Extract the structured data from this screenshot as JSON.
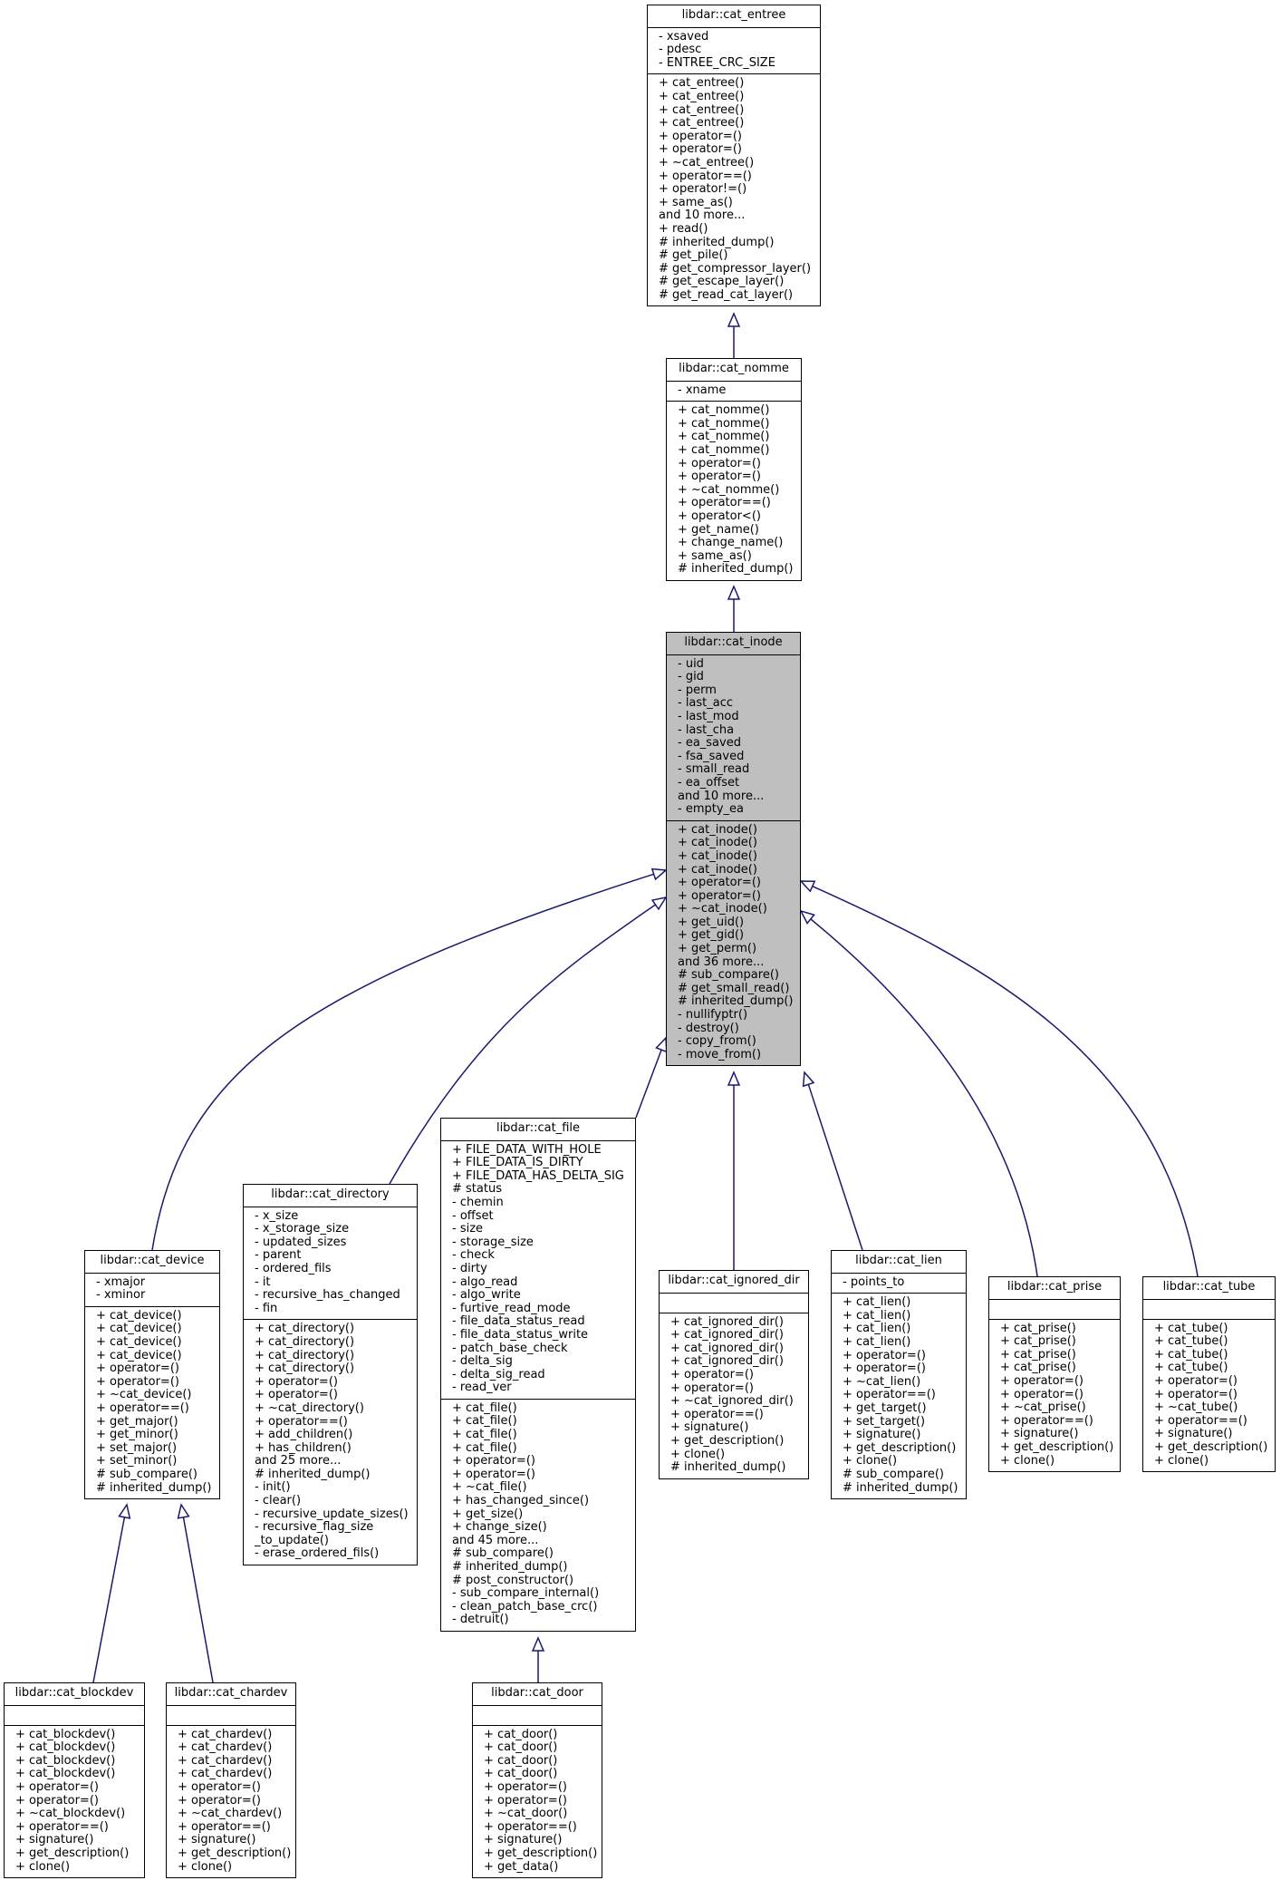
{
  "diagram": {
    "type": "uml-class-inheritance",
    "focus_class": "cat_inode",
    "edge_color": "#191970",
    "focus_fill": "#bfbfbf",
    "classes": [
      {
        "id": "cat_entree",
        "title": "libdar::cat_entree",
        "attributes": [
          "- xsaved",
          "- pdesc",
          "- ENTREE_CRC_SIZE"
        ],
        "methods": [
          "+ cat_entree()",
          "+ cat_entree()",
          "+ cat_entree()",
          "+ cat_entree()",
          "+ operator=()",
          "+ operator=()",
          "+ ~cat_entree()",
          "+ operator==()",
          "+ operator!=()",
          "+ same_as()",
          "and 10 more...",
          "+ read()",
          "# inherited_dump()",
          "# get_pile()",
          "# get_compressor_layer()",
          "# get_escape_layer()",
          "# get_read_cat_layer()"
        ]
      },
      {
        "id": "cat_nomme",
        "title": "libdar::cat_nomme",
        "attributes": [
          "- xname"
        ],
        "methods": [
          "+ cat_nomme()",
          "+ cat_nomme()",
          "+ cat_nomme()",
          "+ cat_nomme()",
          "+ operator=()",
          "+ operator=()",
          "+ ~cat_nomme()",
          "+ operator==()",
          "+ operator<()",
          "+ get_name()",
          "+ change_name()",
          "+ same_as()",
          "# inherited_dump()"
        ]
      },
      {
        "id": "cat_inode",
        "title": "libdar::cat_inode",
        "attributes": [
          "- uid",
          "- gid",
          "- perm",
          "- last_acc",
          "- last_mod",
          "- last_cha",
          "- ea_saved",
          "- fsa_saved",
          "- small_read",
          "- ea_offset",
          "and 10 more...",
          "- empty_ea"
        ],
        "methods": [
          "+ cat_inode()",
          "+ cat_inode()",
          "+ cat_inode()",
          "+ cat_inode()",
          "+ operator=()",
          "+ operator=()",
          "+ ~cat_inode()",
          "+ get_uid()",
          "+ get_gid()",
          "+ get_perm()",
          "and 36 more...",
          "# sub_compare()",
          "# get_small_read()",
          "# inherited_dump()",
          "- nullifyptr()",
          "- destroy()",
          "- copy_from()",
          "- move_from()"
        ]
      },
      {
        "id": "cat_device",
        "title": "libdar::cat_device",
        "attributes": [
          "- xmajor",
          "- xminor"
        ],
        "methods": [
          "+ cat_device()",
          "+ cat_device()",
          "+ cat_device()",
          "+ cat_device()",
          "+ operator=()",
          "+ operator=()",
          "+ ~cat_device()",
          "+ operator==()",
          "+ get_major()",
          "+ get_minor()",
          "+ set_major()",
          "+ set_minor()",
          "# sub_compare()",
          "# inherited_dump()"
        ]
      },
      {
        "id": "cat_directory",
        "title": "libdar::cat_directory",
        "attributes": [
          "- x_size",
          "- x_storage_size",
          "- updated_sizes",
          "- parent",
          "- ordered_fils",
          "- it",
          "- recursive_has_changed",
          "- fin"
        ],
        "methods": [
          "+ cat_directory()",
          "+ cat_directory()",
          "+ cat_directory()",
          "+ cat_directory()",
          "+ operator=()",
          "+ operator=()",
          "+ ~cat_directory()",
          "+ operator==()",
          "+ add_children()",
          "+ has_children()",
          "and 25 more...",
          "# inherited_dump()",
          "- init()",
          "- clear()",
          "- recursive_update_sizes()",
          "- recursive_flag_size",
          "_to_update()",
          "- erase_ordered_fils()"
        ]
      },
      {
        "id": "cat_file",
        "title": "libdar::cat_file",
        "attributes": [
          "+ FILE_DATA_WITH_HOLE",
          "+ FILE_DATA_IS_DIRTY",
          "+ FILE_DATA_HAS_DELTA_SIG",
          "# status",
          "- chemin",
          "- offset",
          "- size",
          "- storage_size",
          "- check",
          "- dirty",
          "- algo_read",
          "- algo_write",
          "- furtive_read_mode",
          "- file_data_status_read",
          "- file_data_status_write",
          "- patch_base_check",
          "- delta_sig",
          "- delta_sig_read",
          "- read_ver"
        ],
        "methods": [
          "+ cat_file()",
          "+ cat_file()",
          "+ cat_file()",
          "+ cat_file()",
          "+ operator=()",
          "+ operator=()",
          "+ ~cat_file()",
          "+ has_changed_since()",
          "+ get_size()",
          "+ change_size()",
          "and 45 more...",
          "# sub_compare()",
          "# inherited_dump()",
          "# post_constructor()",
          "- sub_compare_internal()",
          "- clean_patch_base_crc()",
          "- detruit()"
        ]
      },
      {
        "id": "cat_ignored_dir",
        "title": "libdar::cat_ignored_dir",
        "attributes": [],
        "methods": [
          "+ cat_ignored_dir()",
          "+ cat_ignored_dir()",
          "+ cat_ignored_dir()",
          "+ cat_ignored_dir()",
          "+ operator=()",
          "+ operator=()",
          "+ ~cat_ignored_dir()",
          "+ operator==()",
          "+ signature()",
          "+ get_description()",
          "+ clone()",
          "# inherited_dump()"
        ]
      },
      {
        "id": "cat_lien",
        "title": "libdar::cat_lien",
        "attributes": [
          "- points_to"
        ],
        "methods": [
          "+ cat_lien()",
          "+ cat_lien()",
          "+ cat_lien()",
          "+ cat_lien()",
          "+ operator=()",
          "+ operator=()",
          "+ ~cat_lien()",
          "+ operator==()",
          "+ get_target()",
          "+ set_target()",
          "+ signature()",
          "+ get_description()",
          "+ clone()",
          "# sub_compare()",
          "# inherited_dump()"
        ]
      },
      {
        "id": "cat_prise",
        "title": "libdar::cat_prise",
        "attributes": [],
        "methods": [
          "+ cat_prise()",
          "+ cat_prise()",
          "+ cat_prise()",
          "+ cat_prise()",
          "+ operator=()",
          "+ operator=()",
          "+ ~cat_prise()",
          "+ operator==()",
          "+ signature()",
          "+ get_description()",
          "+ clone()"
        ]
      },
      {
        "id": "cat_tube",
        "title": "libdar::cat_tube",
        "attributes": [],
        "methods": [
          "+ cat_tube()",
          "+ cat_tube()",
          "+ cat_tube()",
          "+ cat_tube()",
          "+ operator=()",
          "+ operator=()",
          "+ ~cat_tube()",
          "+ operator==()",
          "+ signature()",
          "+ get_description()",
          "+ clone()"
        ]
      },
      {
        "id": "cat_blockdev",
        "title": "libdar::cat_blockdev",
        "attributes": [],
        "methods": [
          "+ cat_blockdev()",
          "+ cat_blockdev()",
          "+ cat_blockdev()",
          "+ cat_blockdev()",
          "+ operator=()",
          "+ operator=()",
          "+ ~cat_blockdev()",
          "+ operator==()",
          "+ signature()",
          "+ get_description()",
          "+ clone()"
        ]
      },
      {
        "id": "cat_chardev",
        "title": "libdar::cat_chardev",
        "attributes": [],
        "methods": [
          "+ cat_chardev()",
          "+ cat_chardev()",
          "+ cat_chardev()",
          "+ cat_chardev()",
          "+ operator=()",
          "+ operator=()",
          "+ ~cat_chardev()",
          "+ operator==()",
          "+ signature()",
          "+ get_description()",
          "+ clone()"
        ]
      },
      {
        "id": "cat_door",
        "title": "libdar::cat_door",
        "attributes": [],
        "methods": [
          "+ cat_door()",
          "+ cat_door()",
          "+ cat_door()",
          "+ cat_door()",
          "+ operator=()",
          "+ operator=()",
          "+ ~cat_door()",
          "+ operator==()",
          "+ signature()",
          "+ get_description()",
          "+ get_data()"
        ]
      }
    ],
    "inheritance": [
      {
        "child": "cat_nomme",
        "parent": "cat_entree"
      },
      {
        "child": "cat_inode",
        "parent": "cat_nomme"
      },
      {
        "child": "cat_device",
        "parent": "cat_inode"
      },
      {
        "child": "cat_directory",
        "parent": "cat_inode"
      },
      {
        "child": "cat_file",
        "parent": "cat_inode"
      },
      {
        "child": "cat_ignored_dir",
        "parent": "cat_inode"
      },
      {
        "child": "cat_lien",
        "parent": "cat_inode"
      },
      {
        "child": "cat_prise",
        "parent": "cat_inode"
      },
      {
        "child": "cat_tube",
        "parent": "cat_inode"
      },
      {
        "child": "cat_blockdev",
        "parent": "cat_device"
      },
      {
        "child": "cat_chardev",
        "parent": "cat_device"
      },
      {
        "child": "cat_door",
        "parent": "cat_file"
      }
    ]
  }
}
